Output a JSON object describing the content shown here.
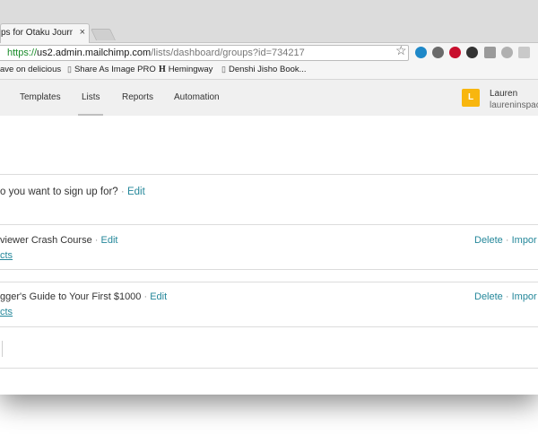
{
  "browser": {
    "tab_title": "ps for Otaku Journalis",
    "tab_close": "×",
    "url_scheme": "https://",
    "url_host": "us2.admin.mailchimp.com",
    "url_path": "/lists/dashboard/groups?id=734217",
    "bookmarks": [
      {
        "label": "ave on delicious"
      },
      {
        "label": "Share As Image PRO"
      },
      {
        "label": "Hemingway"
      },
      {
        "label": "Denshi Jisho Book..."
      }
    ],
    "bookmark_h_glyph": "H",
    "extension_colors": [
      "#1e88c8",
      "#6a6a6a",
      "#c8102e",
      "#333333",
      "#9a9a9a",
      "#b0b0b0",
      "#c9c9c9"
    ]
  },
  "appnav": {
    "items": [
      "Templates",
      "Lists",
      "Reports",
      "Automation"
    ],
    "user_initial": "L",
    "user_name": "Lauren",
    "user_email": "laureninspac"
  },
  "content": {
    "question": "o you want to sign up for?",
    "question_edit": "Edit",
    "groups": [
      {
        "name": "viewer Crash Course",
        "edit": "Edit",
        "contacts": "cts",
        "delete": "Delete",
        "import": "Impor"
      },
      {
        "name": "gger's Guide to Your First $1000",
        "edit": "Edit",
        "contacts": "cts",
        "delete": "Delete",
        "import": "Impor"
      }
    ],
    "separator": "·"
  }
}
